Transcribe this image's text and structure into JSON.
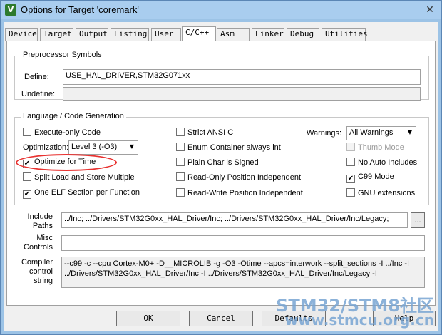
{
  "window": {
    "title": "Options for Target 'coremark'",
    "icon": "uvision-icon",
    "close_glyph": "✕"
  },
  "tabs": [
    {
      "label": "Device",
      "active": false
    },
    {
      "label": "Target",
      "active": false
    },
    {
      "label": "Output",
      "active": false
    },
    {
      "label": "Listing",
      "active": false
    },
    {
      "label": "User",
      "active": false
    },
    {
      "label": "C/C++",
      "active": true
    },
    {
      "label": "Asm",
      "active": false
    },
    {
      "label": "Linker",
      "active": false
    },
    {
      "label": "Debug",
      "active": false
    },
    {
      "label": "Utilities",
      "active": false
    }
  ],
  "preprocessor": {
    "legend": "Preprocessor Symbols",
    "define_label": "Define:",
    "define_value": "USE_HAL_DRIVER,STM32G071xx",
    "undefine_label": "Undefine:",
    "undefine_value": ""
  },
  "language": {
    "legend": "Language / Code Generation",
    "execute_only": {
      "label": "Execute-only Code",
      "checked": false
    },
    "optimization_label": "Optimization:",
    "optimization_value": "Level 3 (-O3)",
    "optimize_time": {
      "label": "Optimize for Time",
      "checked": true
    },
    "split_load": {
      "label": "Split Load and Store Multiple",
      "checked": false
    },
    "one_elf": {
      "label": "One ELF Section per Function",
      "checked": true
    },
    "strict_ansi": {
      "label": "Strict ANSI C",
      "checked": false
    },
    "enum_container": {
      "label": "Enum Container always int",
      "checked": false
    },
    "plain_char": {
      "label": "Plain Char is Signed",
      "checked": false
    },
    "ro_position": {
      "label": "Read-Only Position Independent",
      "checked": false
    },
    "rw_position": {
      "label": "Read-Write Position Independent",
      "checked": false
    },
    "warnings_label": "Warnings:",
    "warnings_value": "All Warnings",
    "thumb_mode": {
      "label": "Thumb Mode",
      "checked": false
    },
    "no_auto_includes": {
      "label": "No Auto Includes",
      "checked": false
    },
    "c99_mode": {
      "label": "C99 Mode",
      "checked": true
    },
    "gnu_extensions": {
      "label": "GNU extensions",
      "checked": false
    }
  },
  "include_paths": {
    "label_line1": "Include",
    "label_line2": "Paths",
    "value": "../Inc;  ../Drivers/STM32G0xx_HAL_Driver/Inc;  ../Drivers/STM32G0xx_HAL_Driver/Inc/Legacy;",
    "browse_label": "..."
  },
  "misc_controls": {
    "label_line1": "Misc",
    "label_line2": "Controls",
    "value": ""
  },
  "compiler_string": {
    "label_line1": "Compiler",
    "label_line2": "control",
    "label_line3": "string",
    "line1": "--c99 -c --cpu Cortex-M0+ -D__MICROLIB -g -O3 -Otime --apcs=interwork --split_sections -I ../Inc -I",
    "line2": "../Drivers/STM32G0xx_HAL_Driver/Inc -I ../Drivers/STM32G0xx_HAL_Driver/Inc/Legacy -I"
  },
  "buttons": {
    "ok": "OK",
    "cancel": "Cancel",
    "defaults": "Defaults",
    "help": "Help"
  },
  "check_glyph": "✔",
  "watermark": {
    "line1": "STM32/STM8社区",
    "line2": "www.stmcu.org.cn"
  },
  "colors": {
    "highlight": "#e8312f",
    "title_bar": "#a9cdef"
  }
}
